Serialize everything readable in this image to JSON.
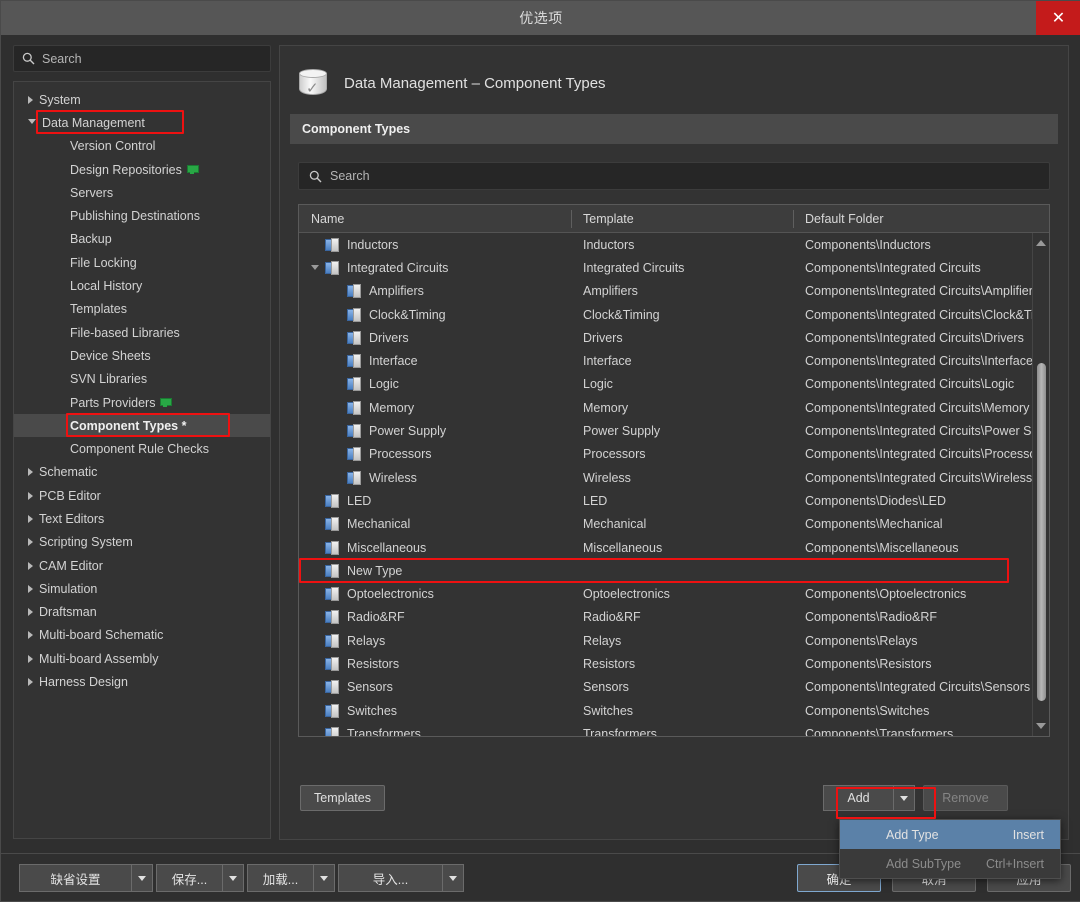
{
  "window": {
    "title": "优选项",
    "close_label": "✕"
  },
  "sidebar": {
    "search_placeholder": "Search",
    "search_icon": "search-icon",
    "items": [
      {
        "label": "System",
        "level": 0,
        "state": "collapsed"
      },
      {
        "label": "Data Management",
        "level": 0,
        "state": "expanded",
        "highlight_box": true
      },
      {
        "label": "Version Control",
        "level": 1,
        "state": "leaf"
      },
      {
        "label": "Design Repositories",
        "level": 1,
        "state": "leaf",
        "badge_icon": "server-icon"
      },
      {
        "label": "Servers",
        "level": 1,
        "state": "leaf"
      },
      {
        "label": "Publishing Destinations",
        "level": 1,
        "state": "leaf"
      },
      {
        "label": "Backup",
        "level": 1,
        "state": "leaf"
      },
      {
        "label": "File Locking",
        "level": 1,
        "state": "leaf"
      },
      {
        "label": "Local History",
        "level": 1,
        "state": "leaf"
      },
      {
        "label": "Templates",
        "level": 1,
        "state": "leaf"
      },
      {
        "label": "File-based Libraries",
        "level": 1,
        "state": "leaf"
      },
      {
        "label": "Device Sheets",
        "level": 1,
        "state": "leaf"
      },
      {
        "label": "SVN Libraries",
        "level": 1,
        "state": "leaf"
      },
      {
        "label": "Parts Providers",
        "level": 1,
        "state": "leaf",
        "badge_icon": "server-icon"
      },
      {
        "label": "Component Types *",
        "level": 1,
        "state": "leaf",
        "selected": true,
        "highlight_box": true
      },
      {
        "label": "Component Rule Checks",
        "level": 1,
        "state": "leaf"
      },
      {
        "label": "Schematic",
        "level": 0,
        "state": "collapsed"
      },
      {
        "label": "PCB Editor",
        "level": 0,
        "state": "collapsed"
      },
      {
        "label": "Text Editors",
        "level": 0,
        "state": "collapsed"
      },
      {
        "label": "Scripting System",
        "level": 0,
        "state": "collapsed"
      },
      {
        "label": "CAM Editor",
        "level": 0,
        "state": "collapsed"
      },
      {
        "label": "Simulation",
        "level": 0,
        "state": "collapsed"
      },
      {
        "label": "Draftsman",
        "level": 0,
        "state": "collapsed"
      },
      {
        "label": "Multi-board Schematic",
        "level": 0,
        "state": "collapsed"
      },
      {
        "label": "Multi-board Assembly",
        "level": 0,
        "state": "collapsed"
      },
      {
        "label": "Harness Design",
        "level": 0,
        "state": "collapsed"
      }
    ]
  },
  "page": {
    "icon": "database-check-icon",
    "title": "Data Management – Component Types",
    "tab_label": "Component Types",
    "search_placeholder": "Search",
    "search_icon": "search-icon"
  },
  "table": {
    "columns": [
      "Name",
      "Template",
      "Default Folder"
    ],
    "rows": [
      {
        "name": "Inductors",
        "indent": 0,
        "expander": "none",
        "template": "Inductors",
        "folder": "Components\\Inductors"
      },
      {
        "name": "Integrated Circuits",
        "indent": 0,
        "expander": "expanded",
        "template": "Integrated Circuits",
        "folder": "Components\\Integrated Circuits"
      },
      {
        "name": "Amplifiers",
        "indent": 1,
        "expander": "none",
        "template": "Amplifiers",
        "folder": "Components\\Integrated Circuits\\Amplifiers"
      },
      {
        "name": "Clock&Timing",
        "indent": 1,
        "expander": "none",
        "template": "Clock&Timing",
        "folder": "Components\\Integrated Circuits\\Clock&Timing"
      },
      {
        "name": "Drivers",
        "indent": 1,
        "expander": "none",
        "template": "Drivers",
        "folder": "Components\\Integrated Circuits\\Drivers"
      },
      {
        "name": "Interface",
        "indent": 1,
        "expander": "none",
        "template": "Interface",
        "folder": "Components\\Integrated Circuits\\Interface"
      },
      {
        "name": "Logic",
        "indent": 1,
        "expander": "none",
        "template": "Logic",
        "folder": "Components\\Integrated Circuits\\Logic"
      },
      {
        "name": "Memory",
        "indent": 1,
        "expander": "none",
        "template": "Memory",
        "folder": "Components\\Integrated Circuits\\Memory"
      },
      {
        "name": "Power Supply",
        "indent": 1,
        "expander": "none",
        "template": "Power Supply",
        "folder": "Components\\Integrated Circuits\\Power Supply"
      },
      {
        "name": "Processors",
        "indent": 1,
        "expander": "none",
        "template": "Processors",
        "folder": "Components\\Integrated Circuits\\Processors"
      },
      {
        "name": "Wireless",
        "indent": 1,
        "expander": "none",
        "template": "Wireless",
        "folder": "Components\\Integrated Circuits\\Wireless"
      },
      {
        "name": "LED",
        "indent": 0,
        "expander": "none",
        "template": "LED",
        "folder": "Components\\Diodes\\LED"
      },
      {
        "name": "Mechanical",
        "indent": 0,
        "expander": "none",
        "template": "Mechanical",
        "folder": "Components\\Mechanical"
      },
      {
        "name": "Miscellaneous",
        "indent": 0,
        "expander": "none",
        "template": "Miscellaneous",
        "folder": "Components\\Miscellaneous"
      },
      {
        "name": "New Type",
        "indent": 0,
        "expander": "none",
        "template": "",
        "folder": "",
        "highlight_box": true
      },
      {
        "name": "Optoelectronics",
        "indent": 0,
        "expander": "none",
        "template": "Optoelectronics",
        "folder": "Components\\Optoelectronics"
      },
      {
        "name": "Radio&RF",
        "indent": 0,
        "expander": "none",
        "template": "Radio&RF",
        "folder": "Components\\Radio&RF"
      },
      {
        "name": "Relays",
        "indent": 0,
        "expander": "none",
        "template": "Relays",
        "folder": "Components\\Relays"
      },
      {
        "name": "Resistors",
        "indent": 0,
        "expander": "none",
        "template": "Resistors",
        "folder": "Components\\Resistors"
      },
      {
        "name": "Sensors",
        "indent": 0,
        "expander": "none",
        "template": "Sensors",
        "folder": "Components\\Integrated Circuits\\Sensors"
      },
      {
        "name": "Switches",
        "indent": 0,
        "expander": "none",
        "template": "Switches",
        "folder": "Components\\Switches"
      },
      {
        "name": "Transformers",
        "indent": 0,
        "expander": "none",
        "template": "Transformers",
        "folder": "Components\\Transformers"
      }
    ]
  },
  "pane_footer": {
    "templates_label": "Templates",
    "add_label": "Add",
    "remove_label": "Remove"
  },
  "dropdown": {
    "items": [
      {
        "label": "Add Type",
        "shortcut": "Insert",
        "highlighted": true,
        "disabled": false
      },
      {
        "label": "Add SubType",
        "shortcut": "Ctrl+Insert",
        "highlighted": false,
        "disabled": true
      }
    ]
  },
  "dialog_footer": {
    "split_buttons": [
      {
        "label": "缺省设置"
      },
      {
        "label": "保存..."
      },
      {
        "label": "加载..."
      },
      {
        "label": "导入..."
      }
    ],
    "ok_label": "确定",
    "cancel_label": "取消",
    "apply_label": "应用"
  },
  "colors": {
    "accent_highlight": "#5b81a8",
    "annotation_red": "#ee1111",
    "close_red": "#c41b1b",
    "window_bg": "#2f2f2f",
    "panel_bg": "#333333",
    "badge_green": "#28a745"
  }
}
